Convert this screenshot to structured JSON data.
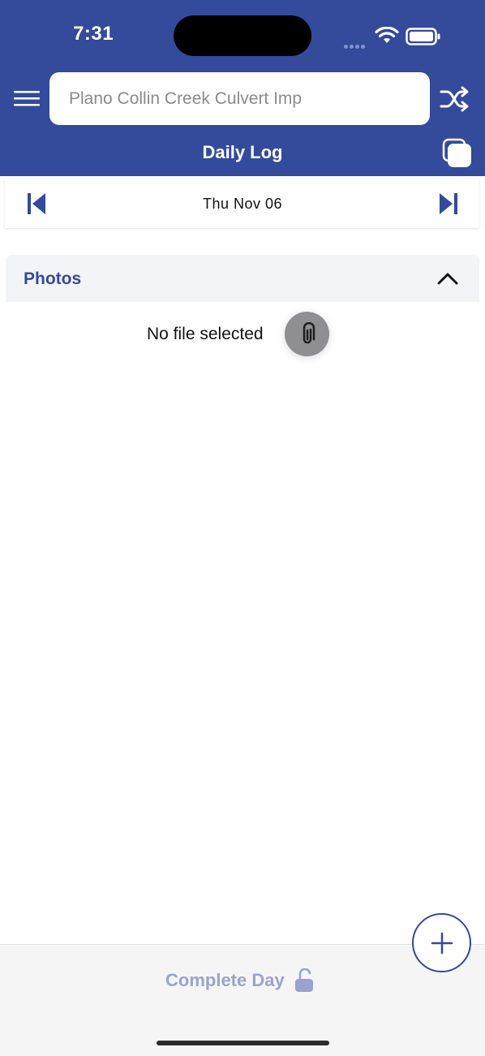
{
  "status_bar": {
    "time": "7:31"
  },
  "header": {
    "project_search": {
      "placeholder": "Plano Collin Creek Culvert Imp"
    },
    "title": "Daily Log",
    "icons": {
      "menu": "menu-icon",
      "shuffle": "shuffle-icon",
      "copy": "copy-icon"
    }
  },
  "date_nav": {
    "date": "Thu Nov 06"
  },
  "photos": {
    "title": "Photos",
    "empty_text": "No file selected"
  },
  "footer": {
    "complete_label": "Complete Day"
  },
  "colors": {
    "brand": "#344a9a",
    "muted_brand": "#9aa3cf",
    "section_bg": "#f3f4f8"
  }
}
